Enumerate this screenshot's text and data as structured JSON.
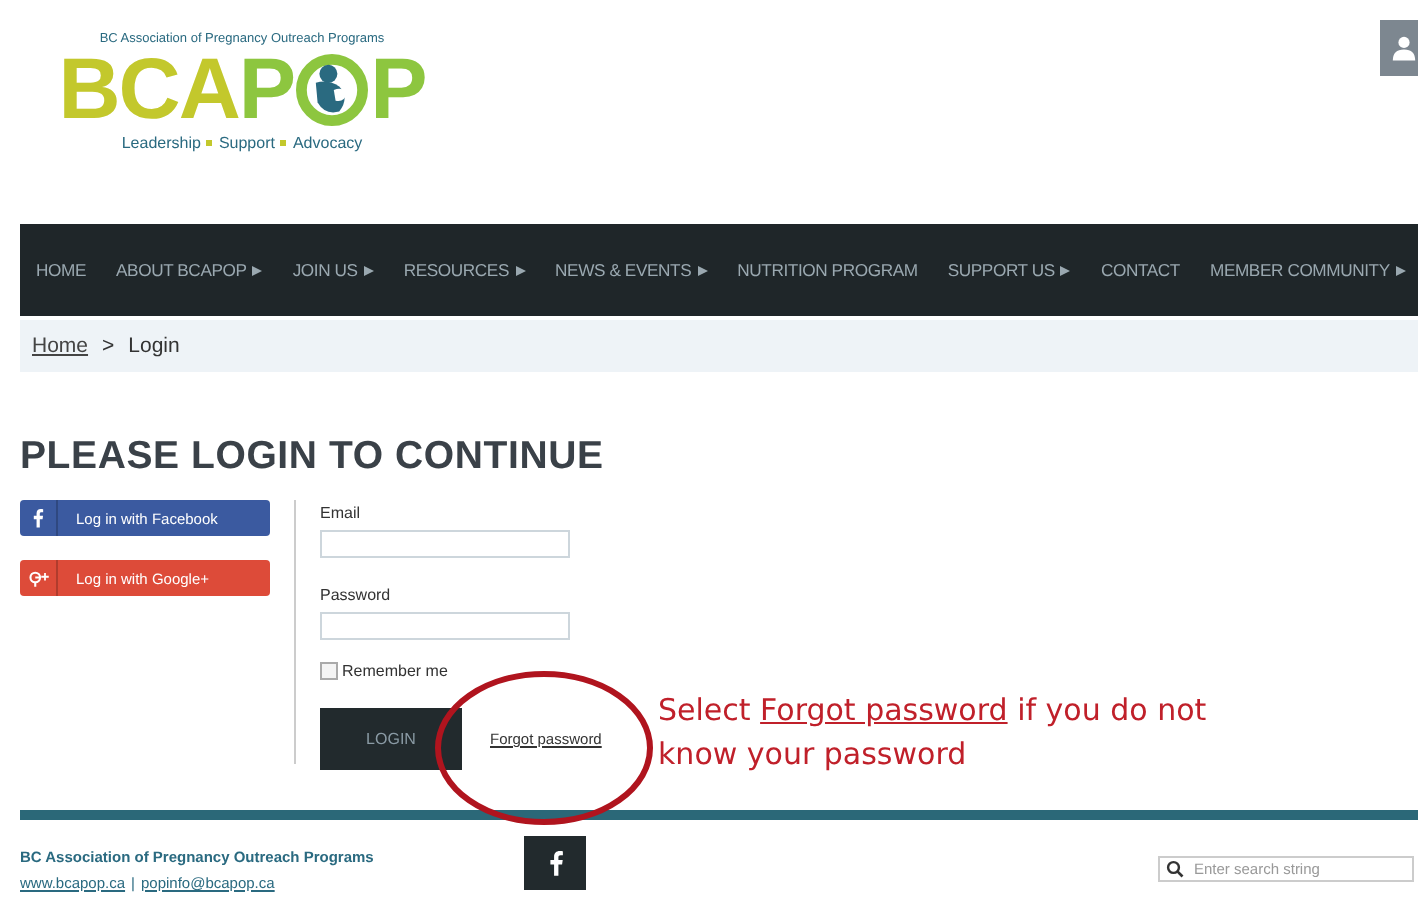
{
  "logo": {
    "organization": "BC Association of Pregnancy Outreach Programs",
    "wordmark_start": "BCA",
    "wordmark_p": "P",
    "wordmark_end": "P",
    "tagline": [
      "Leadership",
      "Support",
      "Advocacy"
    ]
  },
  "nav": [
    {
      "label": "HOME",
      "submenu": false
    },
    {
      "label": "ABOUT BCAPOP",
      "submenu": true
    },
    {
      "label": "JOIN US",
      "submenu": true
    },
    {
      "label": "RESOURCES",
      "submenu": true
    },
    {
      "label": "NEWS & EVENTS",
      "submenu": true
    },
    {
      "label": "NUTRITION PROGRAM",
      "submenu": false
    },
    {
      "label": "SUPPORT US",
      "submenu": true
    },
    {
      "label": "CONTACT",
      "submenu": false
    },
    {
      "label": "MEMBER COMMUNITY",
      "submenu": true
    }
  ],
  "breadcrumb": {
    "home": "Home",
    "separator": ">",
    "current": "Login"
  },
  "heading": "PLEASE LOGIN TO CONTINUE",
  "social_logins": [
    {
      "kind": "facebook",
      "label": "Log in with Facebook"
    },
    {
      "kind": "google",
      "label": "Log in with Google+"
    }
  ],
  "form": {
    "email_label": "Email",
    "password_label": "Password",
    "remember_me": {
      "label": "Remember me",
      "checked": false
    },
    "login_button": "LOGIN",
    "forgot_link": "Forgot password"
  },
  "annotation": {
    "before": "Select",
    "link": "Forgot password",
    "after": "if you do not know your password"
  },
  "footer": {
    "organization": "BC Association of Pregnancy Outreach Programs",
    "website": "www.bcapop.ca",
    "separator": "|",
    "email": "popinfo@bcapop.ca",
    "search": {
      "placeholder": "Enter search string"
    }
  }
}
